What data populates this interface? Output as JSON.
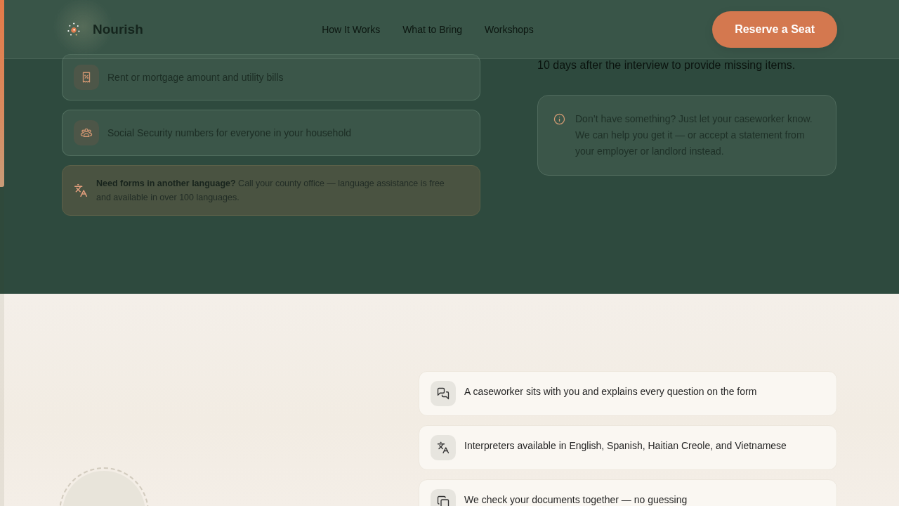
{
  "reading_progress": {
    "level": 0.37
  },
  "header": {
    "brand": "Nourish",
    "nav": [
      {
        "label": "How It Works"
      },
      {
        "label": "What to Bring"
      },
      {
        "label": "Workshops"
      }
    ],
    "button": "Reserve a Seat"
  },
  "documents": {
    "checklist": [
      {
        "text": "Rent or mortgage amount and utility bills"
      },
      {
        "text": "Social Security numbers for everyone in your household"
      }
    ],
    "language_note": "**Need forms in another language?** Call your county office — language assistance is free and available in over 100 languages.",
    "deadline_text": "10 days after the interview to provide missing items.",
    "help_note": "Don’t have something? Just let your caseworker know. We can help you get it — or accept a statement from your employer or landlord instead."
  },
  "interview": {
    "features": [
      {
        "text": "A caseworker sits with you and explains every question on the form"
      },
      {
        "text": "Interpreters available in English, Spanish, Haitian Creole, and Vietnamese"
      },
      {
        "text": "We check your documents together — no guessing"
      }
    ]
  }
}
